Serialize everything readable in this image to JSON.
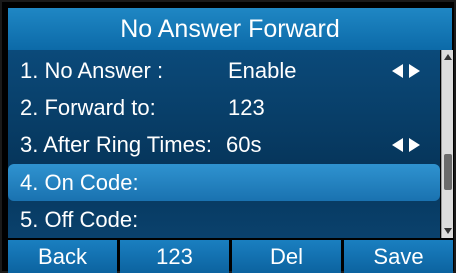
{
  "title": "No Answer Forward",
  "items": [
    {
      "label": "1. No Answer :",
      "value": "Enable",
      "has_arrows": true
    },
    {
      "label": "2. Forward to:",
      "value": "123",
      "has_arrows": false
    },
    {
      "label": "3. After Ring Times:",
      "value": "60s",
      "has_arrows": true
    },
    {
      "label": "4. On Code:",
      "value": "",
      "has_arrows": false,
      "selected": true
    },
    {
      "label": "5. Off Code:",
      "value": "",
      "has_arrows": false
    }
  ],
  "softkeys": [
    "Back",
    "123",
    "Del",
    "Save"
  ],
  "colors": {
    "title_bg": "#1478b8",
    "list_bg": "#06365c",
    "selected_bg": "#2f93d0",
    "softkey_bg": "#1a7fc0"
  },
  "icons": {
    "left": "arrow-left-icon",
    "right": "arrow-right-icon"
  }
}
